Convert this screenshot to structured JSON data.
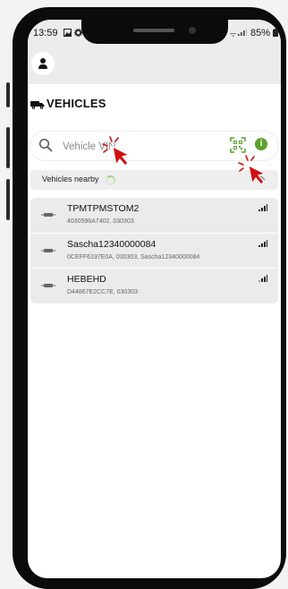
{
  "status_bar": {
    "time": "13:59",
    "battery": "85%",
    "icons": [
      "image-icon",
      "gear-icon",
      "wifi-icon",
      "signal-icon",
      "battery-icon"
    ]
  },
  "header": {
    "avatar_icon": "person-icon"
  },
  "page": {
    "title": "VEHICLES",
    "title_icon": "truck-icon"
  },
  "search": {
    "placeholder": "Vehicle VIN",
    "value": "",
    "icons": [
      "search-icon",
      "qr-scan-icon",
      "info-icon"
    ]
  },
  "nearby": {
    "label": "Vehicles nearby",
    "loading": true
  },
  "vehicles": [
    {
      "name": "TPMTPMSTOM2",
      "details": "4030596A7402, 030303",
      "signal_bars": 3
    },
    {
      "name": "Sascha12340000084",
      "details": "0CEFF6197E0A, 030303, Sascha12340000084",
      "signal_bars": 3
    },
    {
      "name": "HEBEHD",
      "details": "D44867E2CC7E, 030303",
      "signal_bars": 2
    }
  ],
  "colors": {
    "accent_green": "#5aa02c",
    "cursor_red": "#d01010",
    "background": "#ffffff",
    "list_background": "#ebebeb"
  }
}
